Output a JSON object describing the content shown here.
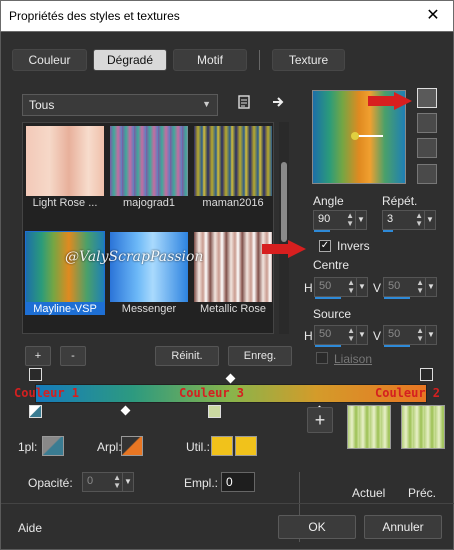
{
  "window": {
    "title": "Propriétés des styles et textures",
    "close_glyph": "✕"
  },
  "tabs": [
    {
      "label": "Couleur"
    },
    {
      "label": "Dégradé"
    },
    {
      "label": "Motif"
    },
    {
      "label": "Texture"
    }
  ],
  "category": {
    "value": "Tous"
  },
  "gradients": [
    {
      "name": "Light Rose ...",
      "selected": false
    },
    {
      "name": "majograd1",
      "selected": false
    },
    {
      "name": "maman2016",
      "selected": false
    },
    {
      "name": "Mayline-VSP",
      "selected": true
    },
    {
      "name": "Messenger",
      "selected": false
    },
    {
      "name": "Metallic Rose",
      "selected": false
    }
  ],
  "watermark": "@ValyScrapPassion",
  "list_buttons": {
    "add": "+",
    "remove": "-",
    "reset": "Réinit.",
    "save": "Enreg."
  },
  "angle": {
    "label": "Angle",
    "value": "90"
  },
  "repeat": {
    "label": "Répét.",
    "value": "3"
  },
  "invert": {
    "label": "Invers",
    "checked": true
  },
  "center": {
    "label": "Centre",
    "h_label": "H",
    "v_label": "V",
    "h": "50",
    "v": "50"
  },
  "source": {
    "label": "Source",
    "h_label": "H",
    "v_label": "V",
    "h": "50",
    "v": "50"
  },
  "link": {
    "label": "Liaison",
    "checked": false
  },
  "color_labels": {
    "c1": "Couleur 1",
    "c3": "Couleur 3",
    "c2": "Couleur 2"
  },
  "stops": {
    "pl_label": "1pl:",
    "arpl_label": "Arpl:",
    "util_label": "Util.:",
    "opacity_label": "Opacité:",
    "opacity": "0",
    "empl_label": "Empl.:",
    "empl": "0",
    "add_glyph": "+"
  },
  "swatches": {
    "current": "Actuel",
    "previous": "Préc."
  },
  "footer": {
    "help": "Aide",
    "ok": "OK",
    "cancel": "Annuler"
  },
  "colors": {
    "accent": "#1e6fd4",
    "stop_yellow": "#f1c21b",
    "stop_orange": "#e87623",
    "stop_teal": "#3a7c92"
  }
}
